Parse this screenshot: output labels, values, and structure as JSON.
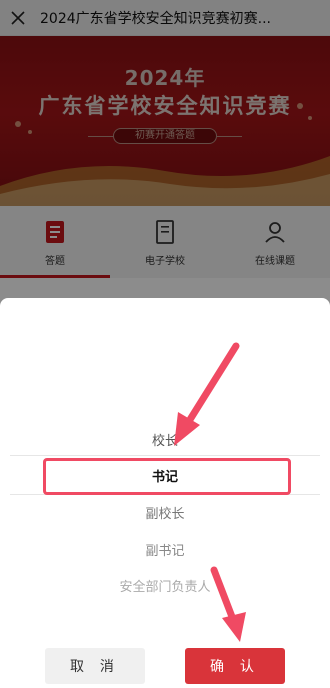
{
  "topbar": {
    "title": "2024广东省学校安全知识竞赛初赛..."
  },
  "banner": {
    "year": "2024年",
    "title": "广东省学校安全知识竞赛",
    "subtitle": "初赛开通答题"
  },
  "tabs": [
    {
      "label": "答题",
      "icon": "quiz-icon"
    },
    {
      "label": "电子学校",
      "icon": "e-school-icon"
    },
    {
      "label": "在线课题",
      "icon": "online-course-icon"
    }
  ],
  "picker": {
    "options": [
      "校长",
      "书记",
      "副校长",
      "副书记",
      "安全部门负责人"
    ],
    "selected": "书记"
  },
  "buttons": {
    "cancel": "取 消",
    "confirm": "确 认"
  },
  "colors": {
    "accent": "#d9343a",
    "highlight": "#f04a63",
    "banner": "#a31518"
  }
}
